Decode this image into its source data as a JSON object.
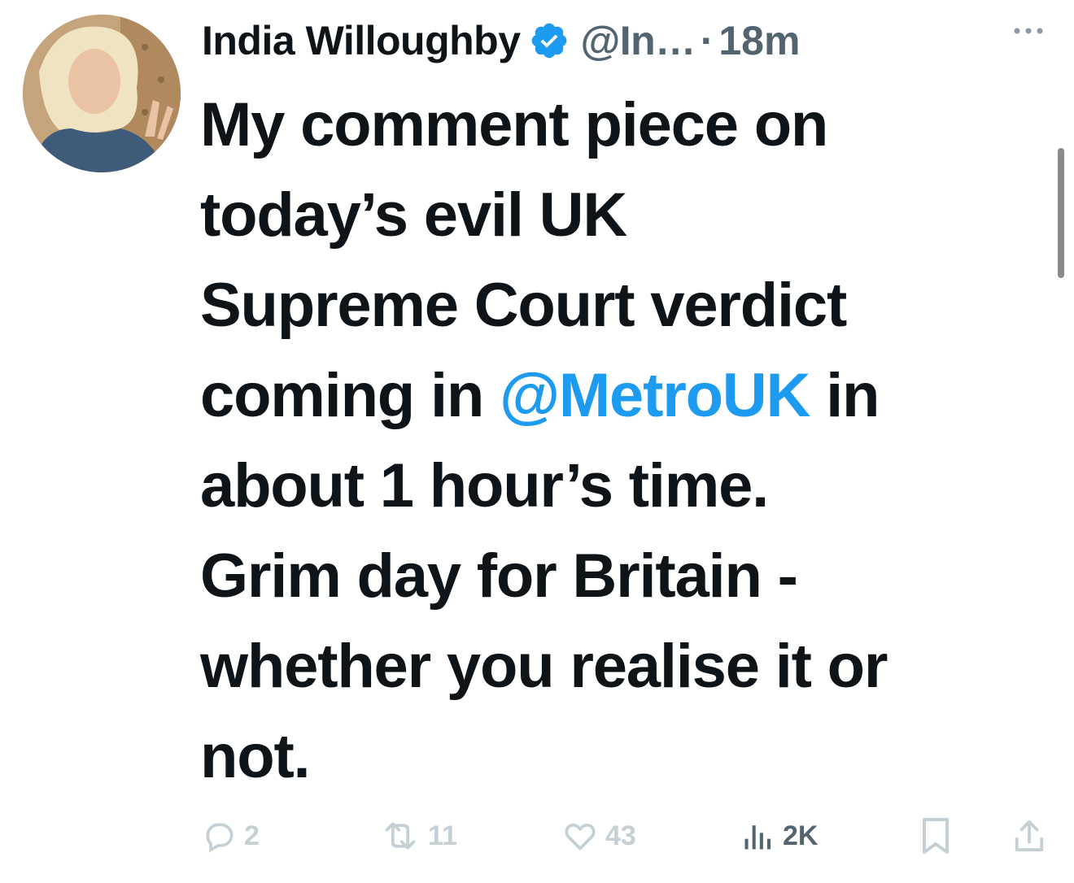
{
  "author": {
    "name": "India Willoughby",
    "handle": "@In…",
    "separator": "·",
    "time": "18m"
  },
  "tweet": {
    "line1": "My comment piece on",
    "line2": "today’s evil UK",
    "line3": "Supreme Court verdict",
    "line4_before": "coming in ",
    "mention": "@MetroUK",
    "line4_after": " in",
    "line5": "about 1 hour’s time.",
    "line6": "Grim day for Britain -",
    "line7": "whether you realise it or",
    "line8": "not."
  },
  "actions": {
    "replies": "2",
    "retweets": "11",
    "likes": "43",
    "views": "2K"
  },
  "icons": {
    "verified": "verified-badge-icon",
    "more": "more-icon",
    "reply": "reply-icon",
    "retweet": "retweet-icon",
    "like": "heart-icon",
    "views": "views-icon",
    "bookmark": "bookmark-icon",
    "share": "share-icon"
  },
  "colors": {
    "text": "#0f1419",
    "secondary": "#536471",
    "link": "#1d9bf0",
    "faded_icon": "#c4cfd6"
  }
}
